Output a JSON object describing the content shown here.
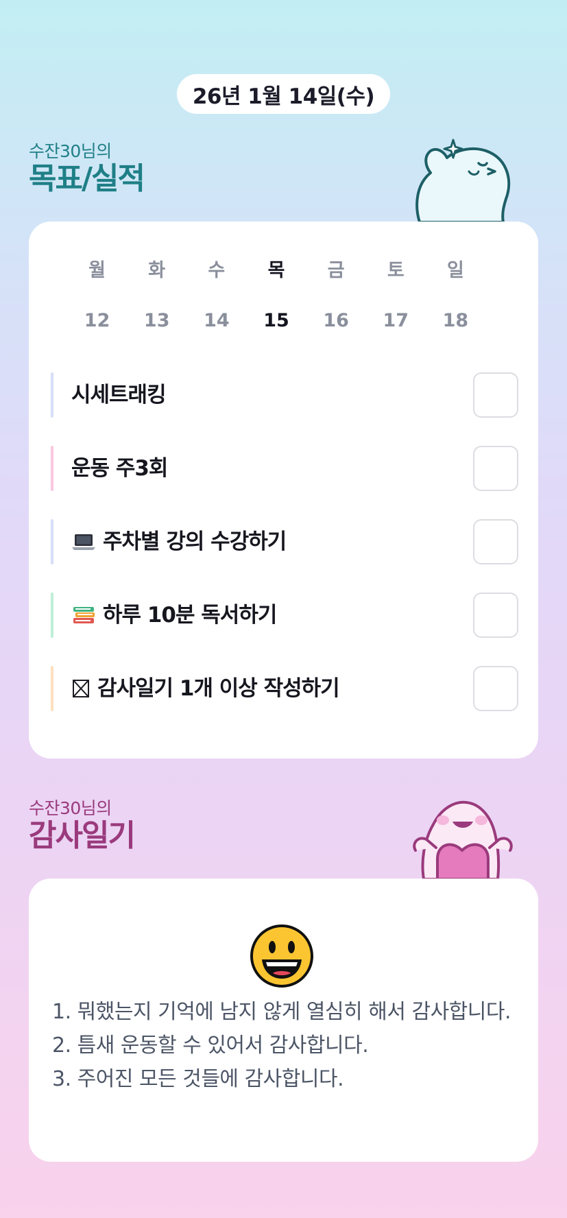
{
  "date_label": "26년 1월 14일(수)",
  "goals_section": {
    "subtitle": "수잔30님의",
    "title": "목표/실적"
  },
  "week": {
    "days": [
      "월",
      "화",
      "수",
      "목",
      "금",
      "토",
      "일"
    ],
    "dates": [
      "12",
      "13",
      "14",
      "15",
      "16",
      "17",
      "18"
    ],
    "today_index": 3
  },
  "goals": [
    {
      "text": "시세트래킹",
      "icon": "",
      "bar_color": "#d6def8",
      "checked": false
    },
    {
      "text": "운동 주3회",
      "icon": "",
      "bar_color": "#f8c8df",
      "checked": false
    },
    {
      "text": "주차별 강의 수강하기",
      "icon": "laptop-icon",
      "bar_color": "#d6def8",
      "checked": false
    },
    {
      "text": "하루 10분 독서하기",
      "icon": "books-icon",
      "bar_color": "#bfeed8",
      "checked": false
    },
    {
      "text": "감사일기 1개 이상 작성하기",
      "icon": "missing-glyph-icon",
      "bar_color": "#fde0bf",
      "checked": false
    }
  ],
  "gratitude_section": {
    "subtitle": "수잔30님의",
    "title": "감사일기"
  },
  "gratitude": {
    "emoji": "grinning-face-icon",
    "lines": [
      "1. 뭐했는지 기억에 남지 않게 열심히 해서 감사합니다.",
      "2. 틈새 운동할 수 있어서 감사합니다.",
      "3. 주어진 모든 것들에 감사합니다."
    ]
  },
  "colors": {
    "goals_accent": "#1f7f86",
    "gratitude_accent": "#9a3a7c",
    "today": "#151520",
    "muted": "#8a8f9c"
  }
}
